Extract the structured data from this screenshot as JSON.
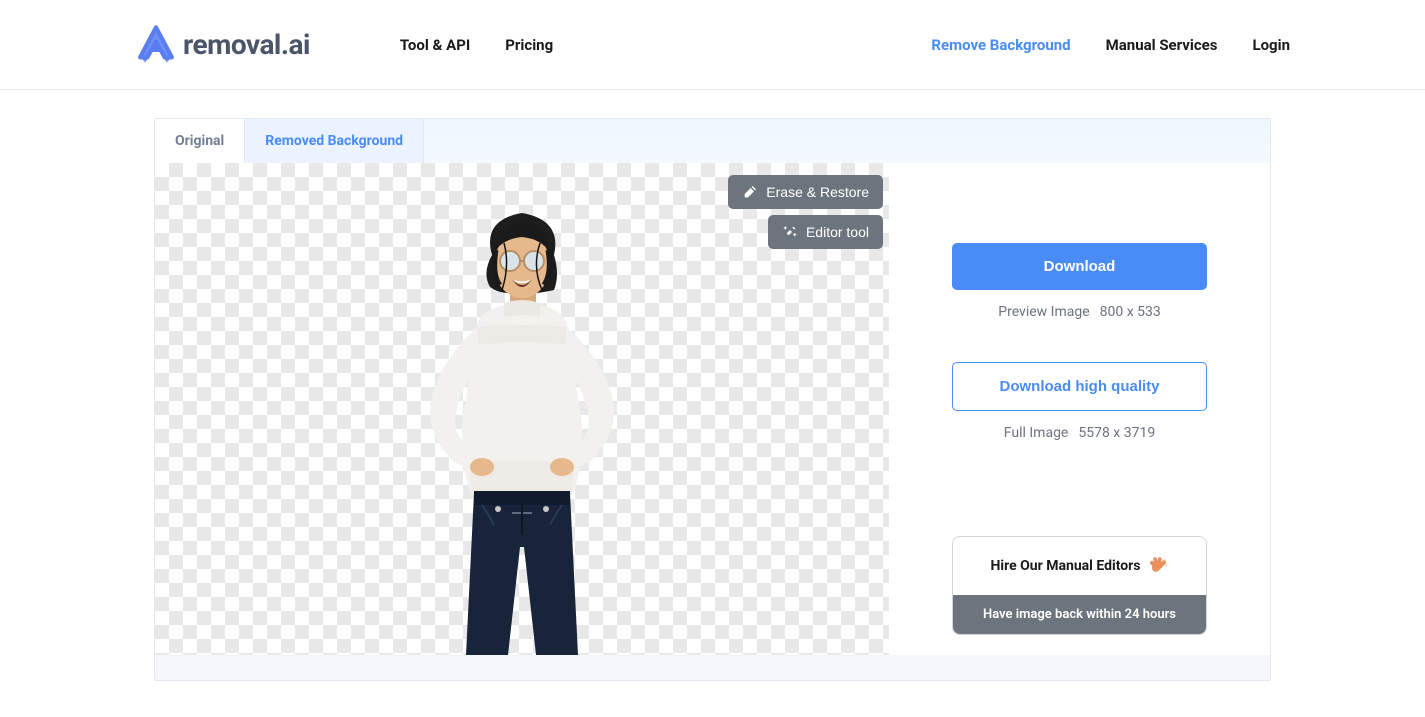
{
  "brand": {
    "name_main": "removal",
    "name_suffix": ".ai"
  },
  "nav": {
    "tool_api": "Tool & API",
    "pricing": "Pricing",
    "remove_bg": "Remove Background",
    "manual_services": "Manual Services",
    "login": "Login"
  },
  "tabs": {
    "original": "Original",
    "removed_bg": "Removed Background"
  },
  "floating": {
    "erase_restore": "Erase & Restore",
    "editor_tool": "Editor tool"
  },
  "sidebar": {
    "download": "Download",
    "preview_label": "Preview Image",
    "preview_dims": "800 x 533",
    "download_hq": "Download high quality",
    "full_label": "Full Image",
    "full_dims": "5578 x 3719",
    "hire_title": "Hire Our Manual Editors",
    "hire_sub": "Have image back within 24 hours"
  }
}
